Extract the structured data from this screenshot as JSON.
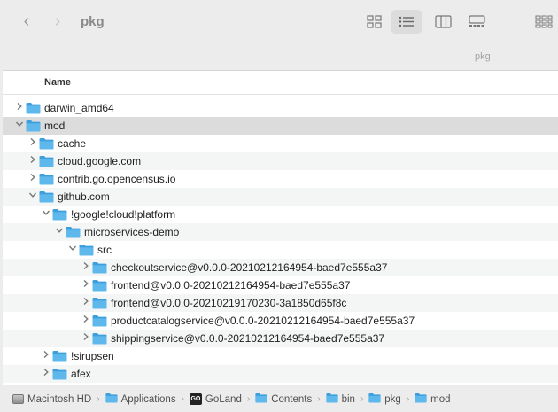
{
  "window": {
    "title": "pkg"
  },
  "toolbar": {
    "back_glyph": "‹",
    "forward_glyph": "›",
    "view_modes": [
      {
        "name": "icon-view-icon",
        "active": false
      },
      {
        "name": "list-view-icon",
        "active": true
      },
      {
        "name": "column-view-icon",
        "active": false
      },
      {
        "name": "gallery-view-icon",
        "active": false
      },
      {
        "name": "group-view-icon",
        "active": false
      }
    ]
  },
  "path_caption": "pkg",
  "columns": {
    "name": "Name"
  },
  "rows": [
    {
      "label": "darwin_amd64",
      "depth": 0,
      "expanded": false,
      "selected": false
    },
    {
      "label": "mod",
      "depth": 0,
      "expanded": true,
      "selected": true
    },
    {
      "label": "cache",
      "depth": 1,
      "expanded": false,
      "selected": false
    },
    {
      "label": "cloud.google.com",
      "depth": 1,
      "expanded": false,
      "selected": false
    },
    {
      "label": "contrib.go.opencensus.io",
      "depth": 1,
      "expanded": false,
      "selected": false
    },
    {
      "label": "github.com",
      "depth": 1,
      "expanded": true,
      "selected": false
    },
    {
      "label": "!google!cloud!platform",
      "depth": 2,
      "expanded": true,
      "selected": false
    },
    {
      "label": "microservices-demo",
      "depth": 3,
      "expanded": true,
      "selected": false
    },
    {
      "label": "src",
      "depth": 4,
      "expanded": true,
      "selected": false
    },
    {
      "label": "checkoutservice@v0.0.0-20210212164954-baed7e555a37",
      "depth": 5,
      "expanded": false,
      "selected": false
    },
    {
      "label": "frontend@v0.0.0-20210212164954-baed7e555a37",
      "depth": 5,
      "expanded": false,
      "selected": false
    },
    {
      "label": "frontend@v0.0.0-20210219170230-3a1850d65f8c",
      "depth": 5,
      "expanded": false,
      "selected": false
    },
    {
      "label": "productcatalogservice@v0.0.0-20210212164954-baed7e555a37",
      "depth": 5,
      "expanded": false,
      "selected": false
    },
    {
      "label": "shippingservice@v0.0.0-20210212164954-baed7e555a37",
      "depth": 5,
      "expanded": false,
      "selected": false
    },
    {
      "label": "!sirupsen",
      "depth": 2,
      "expanded": false,
      "selected": false
    },
    {
      "label": "afex",
      "depth": 2,
      "expanded": false,
      "selected": false
    }
  ],
  "breadcrumbs": [
    {
      "label": "Macintosh HD",
      "icon": "drive-icon"
    },
    {
      "label": "Applications",
      "icon": "folder-icon"
    },
    {
      "label": "GoLand",
      "icon": "goland-app-icon"
    },
    {
      "label": "Contents",
      "icon": "folder-icon"
    },
    {
      "label": "bin",
      "icon": "folder-icon"
    },
    {
      "label": "pkg",
      "icon": "folder-icon"
    },
    {
      "label": "mod",
      "icon": "folder-icon"
    }
  ],
  "goland_icon_text": "GO",
  "breadcrumb_separator": "›",
  "colors": {
    "folder": "#5fb8ec",
    "folder_dark": "#3d9fdc",
    "selection": "#dcdcdc"
  }
}
